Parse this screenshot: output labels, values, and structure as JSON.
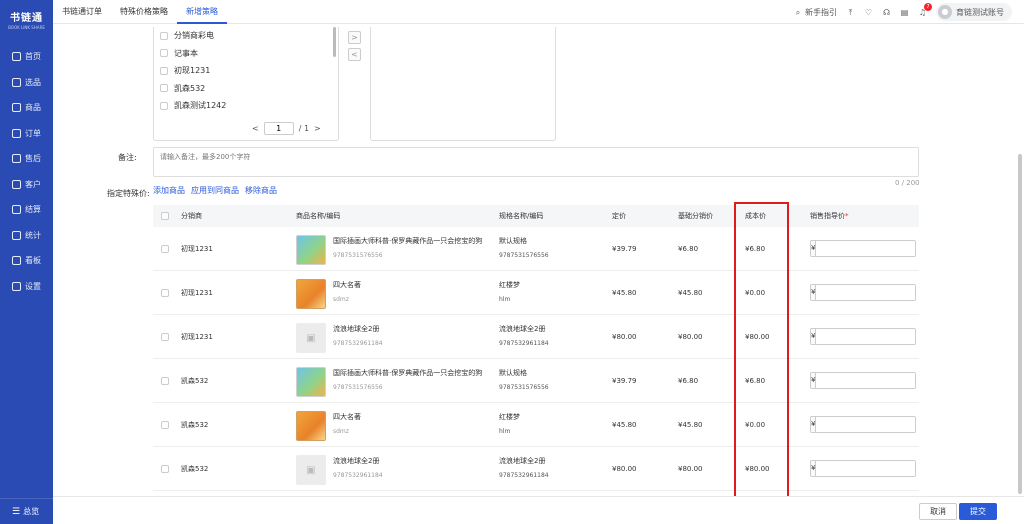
{
  "app": {
    "logo_text": "书链通",
    "logo_sub": "BOOK LINK SHARE"
  },
  "sidebar": {
    "items": [
      {
        "label": "首页"
      },
      {
        "label": "选品"
      },
      {
        "label": "商品"
      },
      {
        "label": "订单"
      },
      {
        "label": "售后"
      },
      {
        "label": "客户"
      },
      {
        "label": "结算"
      },
      {
        "label": "统计"
      },
      {
        "label": "看板"
      },
      {
        "label": "设置"
      }
    ],
    "collapse_label": "总览"
  },
  "header": {
    "tabs": [
      {
        "label": "书链通订单"
      },
      {
        "label": "特殊价格策略"
      },
      {
        "label": "新增策略"
      }
    ],
    "guide_label": "新手指引",
    "notification_count": "7",
    "user_name": "育链测试账号"
  },
  "transfer": {
    "items": [
      {
        "label": "分销商彩电"
      },
      {
        "label": "记事本"
      },
      {
        "label": "初现1231"
      },
      {
        "label": "凯森532"
      },
      {
        "label": "凯森测试1242"
      }
    ],
    "pager_current": "1",
    "pager_total": "/ 1",
    "prev_icon": "<",
    "next_icon": ">",
    "move_right": ">",
    "move_left": "<"
  },
  "form": {
    "remark_label": "备注:",
    "remark_placeholder": "请输入备注，最多200个字符",
    "remark_counter": "0 / 200",
    "spec_label": "指定特殊价:",
    "spec_links": {
      "add": "添加商品",
      "apply": "应用到同商品",
      "remove": "移除商品"
    }
  },
  "table": {
    "headers": {
      "distributor": "分销商",
      "product": "商品名称/编码",
      "spec": "规格名称/编码",
      "list_price": "定价",
      "base_price": "基础分销价",
      "cost": "成本价",
      "guide_price": "销售指导价"
    },
    "currency": "¥",
    "rows": [
      {
        "distributor": "初现1231",
        "product_name": "国际插画大师科普·保罗典藏作品一只会挖宝的狗",
        "product_code": "9787531576556",
        "spec_name": "默认规格",
        "spec_code": "9787531576556",
        "list_price": "¥39.79",
        "base_price": "¥6.80",
        "cost": "¥6.80",
        "thumb": "book1"
      },
      {
        "distributor": "初现1231",
        "product_name": "四大名著",
        "product_code": "sdmz",
        "spec_name": "红楼梦",
        "spec_code": "hlm",
        "list_price": "¥45.80",
        "base_price": "¥45.80",
        "cost": "¥0.00",
        "thumb": "book2"
      },
      {
        "distributor": "初现1231",
        "product_name": "流浪地球全2册",
        "product_code": "9787532961184",
        "spec_name": "流浪地球全2册",
        "spec_code": "9787532961184",
        "list_price": "¥80.00",
        "base_price": "¥80.00",
        "cost": "¥80.00",
        "thumb": "empty"
      },
      {
        "distributor": "凯森532",
        "product_name": "国际插画大师科普·保罗典藏作品一只会挖宝的狗",
        "product_code": "9787531576556",
        "spec_name": "默认规格",
        "spec_code": "9787531576556",
        "list_price": "¥39.79",
        "base_price": "¥6.80",
        "cost": "¥6.80",
        "thumb": "book1"
      },
      {
        "distributor": "凯森532",
        "product_name": "四大名著",
        "product_code": "sdmz",
        "spec_name": "红楼梦",
        "spec_code": "hlm",
        "list_price": "¥45.80",
        "base_price": "¥45.80",
        "cost": "¥0.00",
        "thumb": "book2"
      },
      {
        "distributor": "凯森532",
        "product_name": "流浪地球全2册",
        "product_code": "9787532961184",
        "spec_name": "流浪地球全2册",
        "spec_code": "9787532961184",
        "list_price": "¥80.00",
        "base_price": "¥80.00",
        "cost": "¥80.00",
        "thumb": "empty"
      }
    ]
  },
  "footer": {
    "cancel_label": "取消",
    "submit_label": "提交"
  },
  "colors": {
    "sidebar": "#2a4bb3",
    "accent": "#2a5ad8",
    "highlight": "#e01b1b"
  }
}
